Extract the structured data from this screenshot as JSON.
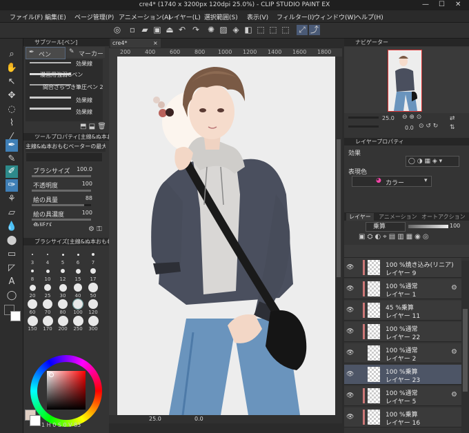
{
  "window": {
    "title": "cre4* (1740 x 3200px 120dpi 25.0%) - CLIP STUDIO PAINT EX",
    "minimize": "—",
    "maximize": "☐",
    "close": "✕"
  },
  "menu": [
    "ファイル(F)",
    "編集(E)",
    "ページ管理(P)",
    "アニメーション(A)",
    "レイヤー(L)",
    "選択範囲(S)",
    "表示(V)",
    "フィルター(I)",
    "ウィンドウ(W)",
    "ヘルプ(H)"
  ],
  "subtool": {
    "header": "サブツール[ペン]",
    "tab_pen": "ペン",
    "tab_marker": "マーカー",
    "brushes": [
      "効果線",
      "漫画用強弱Gペン",
      "間合ざらつき筆圧ペン 2",
      "効果線",
      "効果線"
    ]
  },
  "toolprop": {
    "header": "ツールプロパティ[主線&ぬ本おもむ",
    "preset": "主線&ぬ本おもむペーターの最大ペン",
    "rows": [
      {
        "label": "ブラシサイズ",
        "value": "100.0"
      },
      {
        "label": "不透明度",
        "value": "100"
      },
      {
        "label": "絵の具量",
        "value": "88"
      },
      {
        "label": "絵の具濃度",
        "value": "100"
      },
      {
        "label": "色延び",
        "value": ""
      }
    ]
  },
  "brushsize": {
    "header": "ブラシサイズ[主線&ぬ本おもむ",
    "sizes": [
      "3",
      "4",
      "5",
      "6",
      "7",
      "8",
      "10",
      "12",
      "15",
      "17",
      "20",
      "25",
      "30",
      "40",
      "50",
      "60",
      "70",
      "80",
      "100",
      "120",
      "150",
      "170",
      "200",
      "250",
      "300"
    ]
  },
  "color": {
    "readout": "1 H 0 S 0 V 83",
    "main": "#e0cfc3",
    "sub": "#ffffff"
  },
  "canvas": {
    "tab": "cre4*",
    "ruler_marks": [
      "200",
      "400",
      "600",
      "800",
      "1000",
      "1200",
      "1400",
      "1600",
      "1800"
    ],
    "zoom": "25.0",
    "angle": "0.0"
  },
  "navigator": {
    "header": "ナビゲーター",
    "zoom": "25.0",
    "angle": "0.0"
  },
  "layerprop": {
    "header": "レイヤープロパティ",
    "effect_label": "効果",
    "display_color_label": "表現色",
    "color_mode": "カラー"
  },
  "layerpanel": {
    "tabs": [
      "レイヤー",
      "アニメーション",
      "オートアクション"
    ],
    "blend_mode": "乗算",
    "opacity": "100",
    "layers": [
      {
        "mode": "100 %焼き込み(リニア)",
        "name": "レイヤー 9",
        "mark": "#c77",
        "selected": false,
        "icon": ""
      },
      {
        "mode": "100 %通常",
        "name": "レイヤー 1",
        "mark": "#c77",
        "selected": false,
        "icon": "⚙"
      },
      {
        "mode": "45 %乗算",
        "name": "レイヤー 11",
        "mark": "#c77",
        "selected": false,
        "icon": ""
      },
      {
        "mode": "100 %通常",
        "name": "レイヤー 22",
        "mark": "#c77",
        "selected": false,
        "icon": ""
      },
      {
        "mode": "100 %通常",
        "name": "レイヤー 2",
        "mark": "",
        "selected": false,
        "icon": "⚙"
      },
      {
        "mode": "100 %乗算",
        "name": "レイヤー 23",
        "mark": "",
        "selected": true,
        "icon": ""
      },
      {
        "mode": "100 %通常",
        "name": "レイヤー 5",
        "mark": "#c77",
        "selected": false,
        "icon": "⚙"
      },
      {
        "mode": "100 %乗算",
        "name": "レイヤー 16",
        "mark": "#c77",
        "selected": false,
        "icon": ""
      }
    ]
  }
}
